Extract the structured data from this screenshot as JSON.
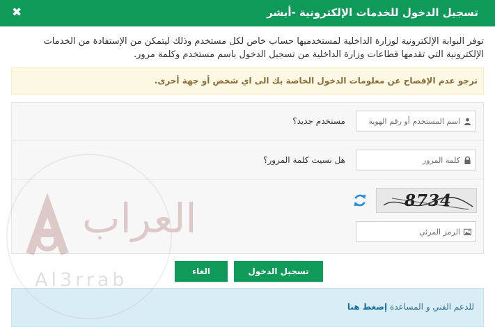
{
  "header": {
    "title": "تسجيل الدخول للخدمات الإلكترونية -أبشر",
    "close_glyph": "✖"
  },
  "intro_text": "توفر البوابة الإلكترونية لوزارة الداخلية لمستخدميها حساب خاص لكل مستخدم وذلك ليتمكن من الإستفادة من الخدمات الإلكترونية التي تقدمها قطاعات وزارة الداخلية من تسجيل الدخول باسم مستخدم وكلمة مرور.",
  "warning_text": "نرجو عدم الإفصاح عن معلومات الدخول الخاصة بك الى اي شخص أو جهة أخرى.",
  "form": {
    "username_placeholder": "اسم المستخدم أو رقم الهوية",
    "new_user_link": "مستخدم جديد؟",
    "password_placeholder": "كلمة المرور",
    "forgot_password_link": "هل نسيت كلمة المرور؟",
    "captcha_value": "8734",
    "captcha_placeholder": "الرمز المرئي"
  },
  "buttons": {
    "login": "تسجيل الدخول",
    "cancel": "الغاء"
  },
  "support": {
    "text": "للدعم الفني و المساعدة",
    "link": "إضغط هنا"
  },
  "watermark": {
    "latin": "Al3rrab",
    "arabic": "العراب"
  },
  "colors": {
    "primary_green": "#0f9a5a",
    "warning_bg": "#fcf8e3",
    "info_bg": "#d9edf7",
    "refresh_blue": "#2a8fd6"
  }
}
